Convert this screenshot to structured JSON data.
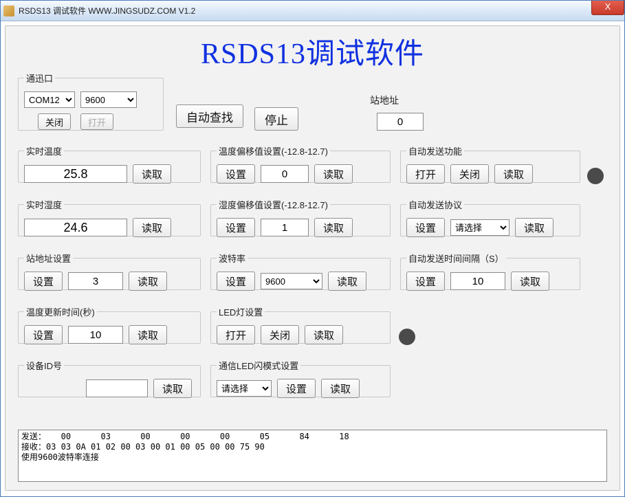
{
  "window": {
    "title": "RSDS13 调试软件 WWW.JINGSUDZ.COM V1.2",
    "close_icon": "X"
  },
  "main_title": "RSDS13调试软件",
  "comm": {
    "legend": "通迅口",
    "port": "COM12",
    "baud": "9600",
    "close_label": "关闭",
    "open_label": "打开"
  },
  "auto_search_label": "自动查找",
  "stop_label": "停止",
  "station_addr": {
    "label": "站地址",
    "value": "0"
  },
  "realtime_temp": {
    "legend": "实时温度",
    "value": "25.8",
    "read_label": "读取"
  },
  "realtime_humi": {
    "legend": "实时湿度",
    "value": "24.6",
    "read_label": "读取"
  },
  "station_addr_set": {
    "legend": "站地址设置",
    "set_label": "设置",
    "value": "3",
    "read_label": "读取"
  },
  "temp_update_time": {
    "legend": "温度更新时间(秒)",
    "set_label": "设置",
    "value": "10",
    "read_label": "读取"
  },
  "device_id": {
    "legend": "设备ID号",
    "value": "",
    "read_label": "读取"
  },
  "temp_offset": {
    "legend": "温度偏移值设置(-12.8-12.7)",
    "set_label": "设置",
    "value": "0",
    "read_label": "读取"
  },
  "humi_offset": {
    "legend": "湿度偏移值设置(-12.8-12.7)",
    "set_label": "设置",
    "value": "1",
    "read_label": "读取"
  },
  "baud_rate": {
    "legend": "波特率",
    "set_label": "设置",
    "value": "9600",
    "read_label": "读取"
  },
  "led_set": {
    "legend": "LED灯设置",
    "open_label": "打开",
    "close_label": "关闭",
    "read_label": "读取"
  },
  "comm_led_blink": {
    "legend": "通信LED闪模式设置",
    "select": "请选择",
    "set_label": "设置",
    "read_label": "读取"
  },
  "auto_send_func": {
    "legend": "自动发送功能",
    "open_label": "打开",
    "close_label": "关闭",
    "read_label": "读取"
  },
  "auto_send_proto": {
    "legend": "自动发送协议",
    "set_label": "设置",
    "select": "请选择",
    "read_label": "读取"
  },
  "auto_send_interval": {
    "legend": "自动发送时间间隔（S）",
    "set_label": "设置",
    "value": "10",
    "read_label": "读取"
  },
  "log": "发送：   00      03      00      00      00      05      84      18\n接收：03 03 0A 01 02 00 03 00 01 00 05 00 00 75 90\n使用9600波特率连接\n"
}
